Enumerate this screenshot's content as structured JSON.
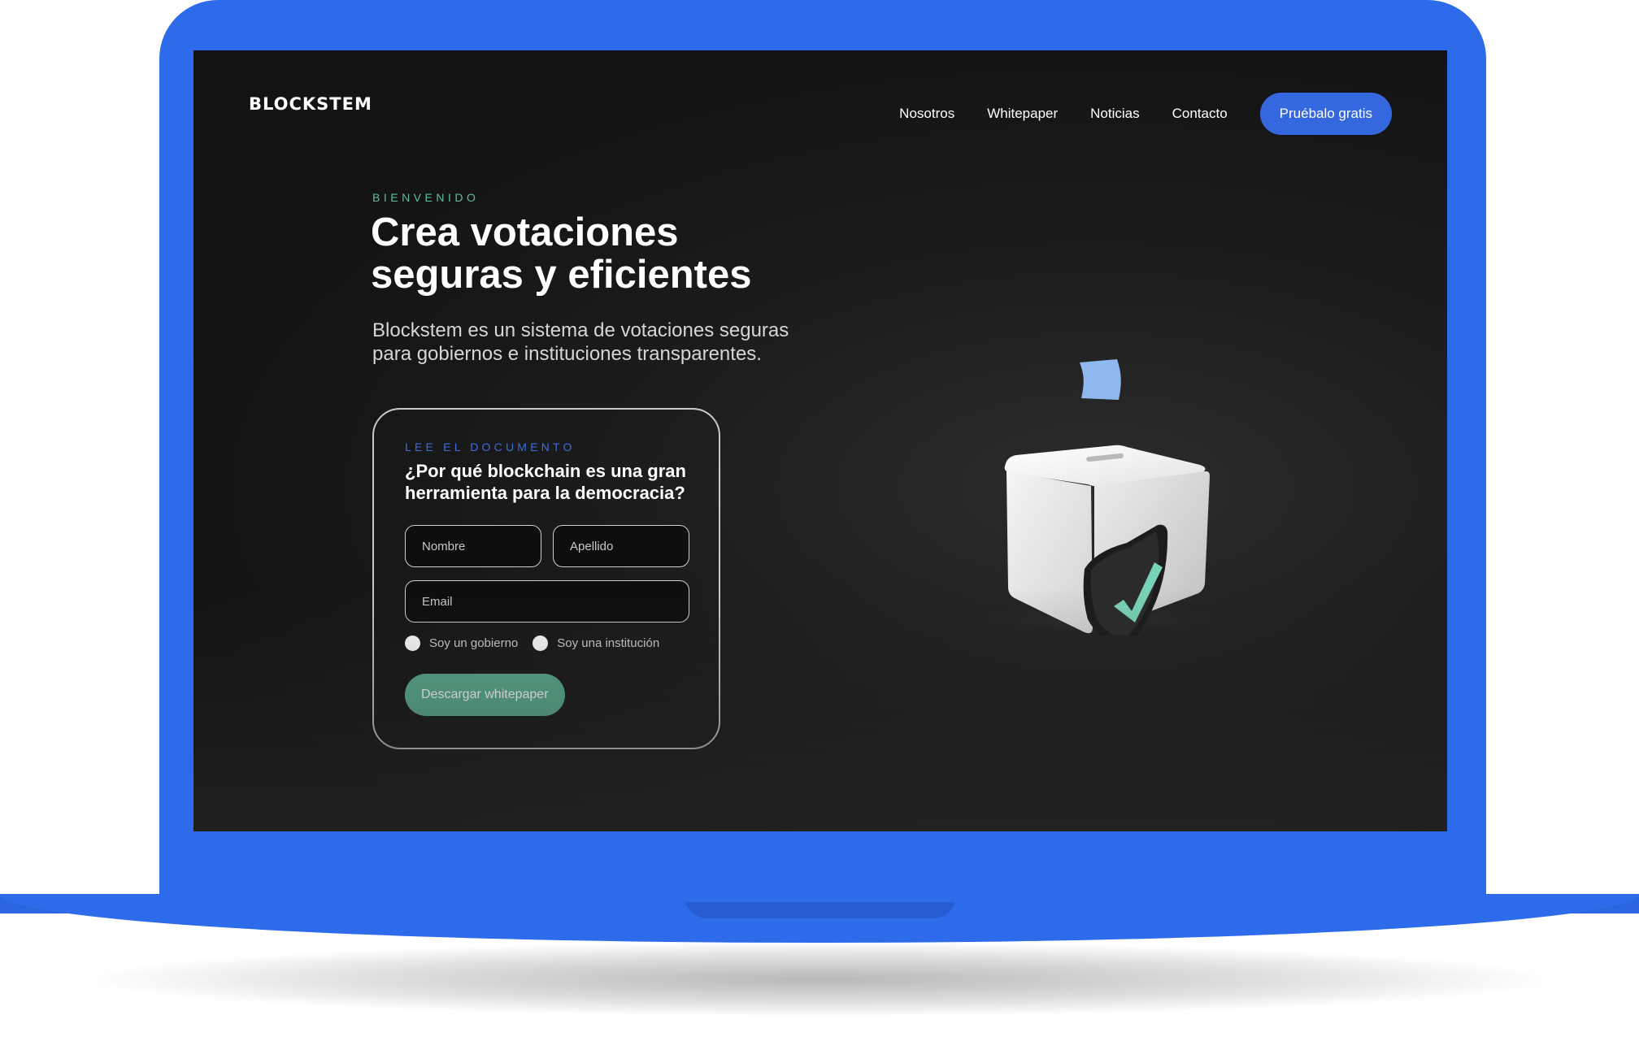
{
  "brand": {
    "logo": "BLOCKSTEM"
  },
  "nav": {
    "items": [
      {
        "label": "Nosotros"
      },
      {
        "label": "Whitepaper"
      },
      {
        "label": "Noticias"
      },
      {
        "label": "Contacto"
      }
    ],
    "cta_label": "Pruébalo gratis"
  },
  "hero": {
    "eyebrow": "BIENVENIDO",
    "title_line1": "Crea votaciones",
    "title_line2": "seguras y eficientes",
    "subtitle_line1": "Blockstem es un sistema de votaciones seguras",
    "subtitle_line2": "para gobiernos e instituciones transparentes."
  },
  "form": {
    "eyebrow": "LEE EL DOCUMENTO",
    "title_line1": "¿Por qué blockchain es una gran",
    "title_line2": "herramienta para la democracia?",
    "nombre_placeholder": "Nombre",
    "apellido_placeholder": "Apellido",
    "email_placeholder": "Email",
    "radio_options": [
      {
        "label": "Soy un gobierno"
      },
      {
        "label": "Soy una institución"
      }
    ],
    "submit_label": "Descargar whitepaper"
  },
  "illustration": {
    "icon": "ballot-box-shield-check-icon"
  },
  "colors": {
    "device_blue": "#2d6bea",
    "screen_bg": "#1b1b1b",
    "accent_blue": "#3567df",
    "accent_green": "#5aad8e",
    "eyebrow_green": "#5fbf9b"
  }
}
